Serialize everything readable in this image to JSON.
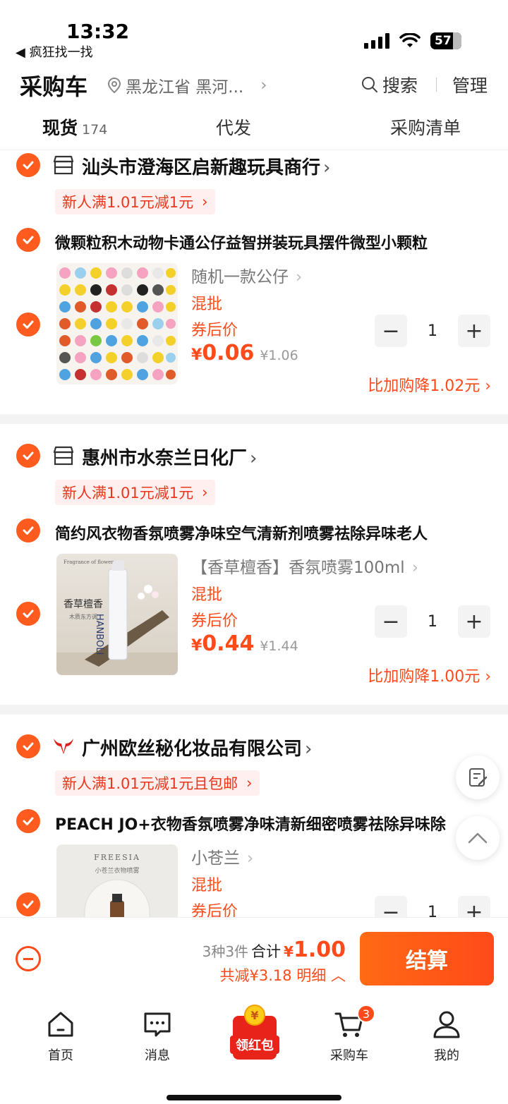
{
  "status_bar": {
    "time": "13:32",
    "back_app": "◀ 疯狂找一找",
    "battery": "57"
  },
  "header": {
    "title": "采购车",
    "location": "黑龙江省 黑河...",
    "search_label": "搜索",
    "manage_label": "管理"
  },
  "tabs": [
    {
      "label": "现货",
      "count": "174",
      "active": true
    },
    {
      "label": "代发"
    },
    {
      "label": "采购清单"
    }
  ],
  "shops": [
    {
      "name": "汕头市澄海区启新趣玩具商行",
      "promo": "新人满1.01元减1元",
      "item": {
        "title": "微颗粒积木动物卡通公仔益智拼装玩具摆件微型小颗粒",
        "sku": "随机一款公仔",
        "tag": "混批",
        "after_coupon": "券后价",
        "price_yen": "¥",
        "price": "0.06",
        "orig_price": "¥1.06",
        "qty": "1",
        "save_more": "比加购降1.02元"
      }
    },
    {
      "name": "惠州市水奈兰日化厂",
      "promo": "新人满1.01元减1元",
      "item": {
        "title": "简约风衣物香氛喷雾净味空气清新剂喷雾祛除异味老人",
        "sku": "【香草檀香】香氛喷雾100ml",
        "tag": "混批",
        "after_coupon": "券后价",
        "price_yen": "¥",
        "price": "0.44",
        "orig_price": "¥1.44",
        "qty": "1",
        "save_more": "比加购降1.00元",
        "thumb_text": {
          "tagline": "Fragrance of flower",
          "name": "香草檀香",
          "sub": "木质东方调",
          "brand": "HANBOLI"
        }
      }
    },
    {
      "name": "广州欧丝秘化妆品有限公司",
      "promo": "新人满1.01元减1元且包邮",
      "item": {
        "title": "PEACH JO+衣物香氛喷雾净味清新细密喷雾祛除异味除",
        "sku": "小苍兰",
        "tag": "混批",
        "after_coupon": "券后价",
        "qty": "1",
        "thumb_text": {
          "brand": "FREESIA",
          "name": "小苍兰衣物喷雾"
        }
      }
    }
  ],
  "checkout": {
    "kinds": "3种3件",
    "total_label": "合计",
    "total_yen": "¥",
    "total": "1.00",
    "discount": "共减¥3.18 明细",
    "button": "结算"
  },
  "tabbar": {
    "home": "首页",
    "messages": "消息",
    "redpack": "领红包",
    "cart": "采购车",
    "cart_badge": "3",
    "mine": "我的"
  },
  "colors": {
    "accent": "#ff4a1a",
    "promo_bg": "#fff0ef",
    "promo_text": "#e8371d"
  }
}
